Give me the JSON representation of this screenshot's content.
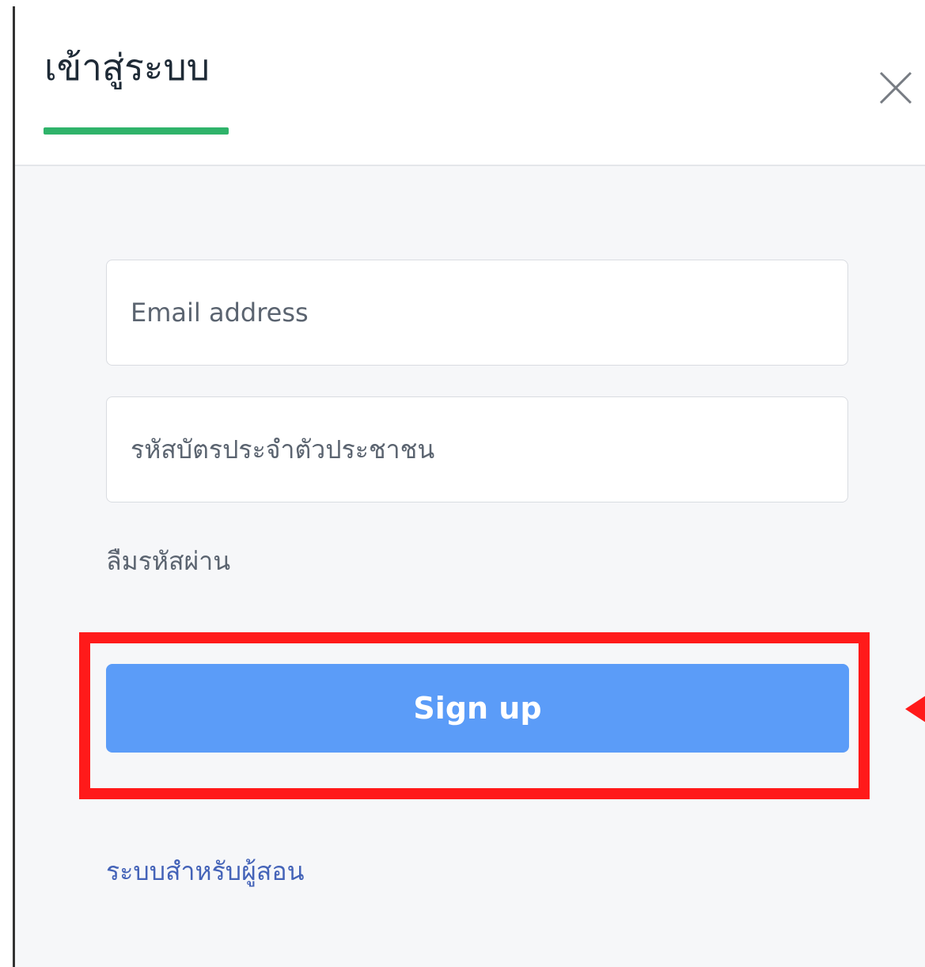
{
  "header": {
    "tab_title": "เข้าสู่ระบบ",
    "close_icon": "close-icon"
  },
  "form": {
    "email": {
      "value": "",
      "placeholder": "Email address"
    },
    "id_card": {
      "value": "",
      "placeholder": "รหัสบัตรประจำตัวประชาชน"
    },
    "forgot_password_label": "ลืมรหัสผ่าน",
    "signup_label": "Sign up",
    "instructor_link_label": "ระบบสำหรับผู้สอน"
  },
  "annotation": {
    "highlight_color": "#ff1a1a"
  },
  "colors": {
    "tab_underline": "#2fb36a",
    "primary_button": "#5b9cf8",
    "link": "#4463b8"
  }
}
